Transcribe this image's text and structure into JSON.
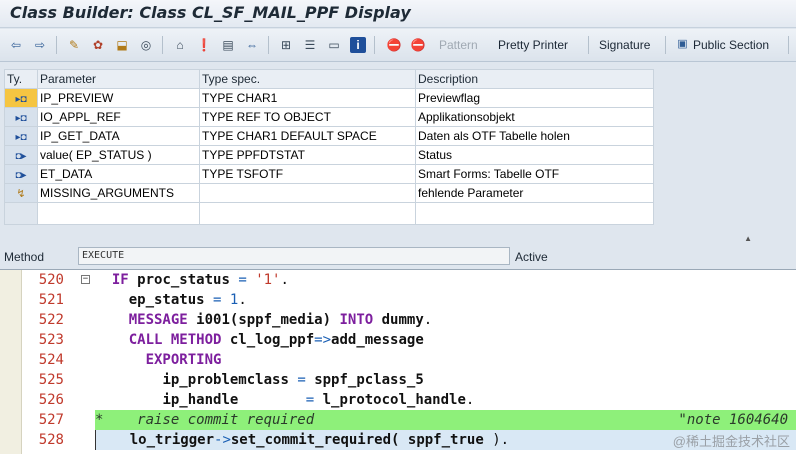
{
  "window": {
    "title": "Class Builder: Class CL_SF_MAIL_PPF Display"
  },
  "toolbar": {
    "pattern_label": "Pattern",
    "pretty_printer_label": "Pretty Printer",
    "signature_label": "Signature",
    "public_section_label": "Public Section",
    "icons": [
      "back-icon",
      "forward-icon",
      "edit-icon",
      "activate-icon",
      "check-icon",
      "test-icon",
      "where-used-icon",
      "navigate-icon",
      "display-object-list-icon",
      "insert-icon",
      "move-icon",
      "hierarchy-icon",
      "stack-icon",
      "window-icon",
      "info-icon",
      "breakpoint-icon",
      "external-breakpoint-icon"
    ]
  },
  "params": {
    "headers": {
      "ty": "Ty.",
      "parameter": "Parameter",
      "type_spec": "Type spec.",
      "description": "Description"
    },
    "rows": [
      {
        "icon": "importing-param-icon",
        "parameter": "IP_PREVIEW",
        "type_spec": "TYPE CHAR1",
        "description": "Previewflag"
      },
      {
        "icon": "importing-param-icon",
        "parameter": "IO_APPL_REF",
        "type_spec": "TYPE REF TO OBJECT",
        "description": "Applikationsobjekt"
      },
      {
        "icon": "importing-param-icon",
        "parameter": "IP_GET_DATA",
        "type_spec": "TYPE CHAR1  DEFAULT SPACE",
        "description": "Daten als OTF Tabelle holen"
      },
      {
        "icon": "returning-param-icon",
        "parameter": "value( EP_STATUS )",
        "type_spec": "TYPE PPFDTSTAT",
        "description": "Status"
      },
      {
        "icon": "exporting-param-icon",
        "parameter": "ET_DATA",
        "type_spec": "TYPE TSFOTF",
        "description": "Smart Forms: Tabelle OTF"
      },
      {
        "icon": "exception-icon",
        "parameter": "MISSING_ARGUMENTS",
        "type_spec": "",
        "description": "fehlende Parameter"
      }
    ]
  },
  "method": {
    "label": "Method",
    "name": "EXECUTE",
    "status": "Active"
  },
  "editor": {
    "lines": [
      {
        "no": "520",
        "type": "normal",
        "fold": "−"
      },
      {
        "no": "521",
        "type": "normal"
      },
      {
        "no": "522",
        "type": "normal"
      },
      {
        "no": "523",
        "type": "normal"
      },
      {
        "no": "524",
        "type": "normal"
      },
      {
        "no": "525",
        "type": "normal"
      },
      {
        "no": "526",
        "type": "normal"
      },
      {
        "no": "527",
        "type": "comment"
      },
      {
        "no": "528",
        "type": "current"
      }
    ],
    "code": {
      "l520": {
        "kw1": "IF",
        "id": "proc_status",
        "op": "=",
        "str": "'1'",
        "end": "."
      },
      "l521": {
        "id": "ep_status",
        "op": "=",
        "num": "1",
        "end": "."
      },
      "l522": {
        "kw1": "MESSAGE",
        "id": "i001(sppf_media)",
        "kw2": "INTO",
        "id2": "dummy",
        "end": "."
      },
      "l523": {
        "kw1": "CALL METHOD",
        "id": "cl_log_ppf",
        "op": "=>",
        "id2": "add_message"
      },
      "l524": {
        "kw1": "EXPORTING"
      },
      "l525": {
        "id": "ip_problemclass",
        "op": "=",
        "id2": "sppf_pclass_5"
      },
      "l526": {
        "id": "ip_handle",
        "op": "=",
        "id2": "l_protocol_handle",
        "end": "."
      },
      "l527": {
        "text": "*    raise commit required",
        "right": "\"note 1604640"
      },
      "l528": {
        "id": "lo_trigger",
        "op": "->",
        "id2": "set_commit_required(",
        "id3": "sppf_true",
        "end": ")."
      }
    }
  },
  "watermark": "@稀土掘金技术社区"
}
